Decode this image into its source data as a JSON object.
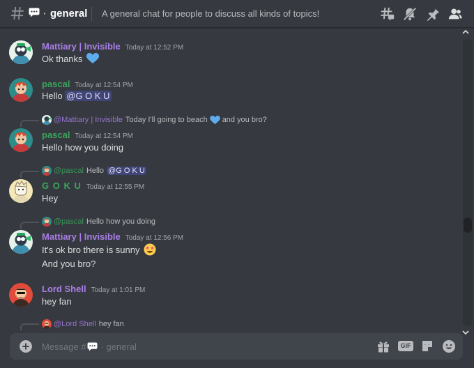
{
  "header": {
    "channel_dot": "·",
    "channel_name": "general",
    "topic": "A general chat for people to discuss all kinds of topics!",
    "icons": [
      "threads-icon",
      "mute-bell-icon",
      "pin-icon",
      "members-icon"
    ]
  },
  "colors": {
    "purple_name": "#a97ee7",
    "green_name": "#3ba55d",
    "mention_bg": "#414675",
    "bg": "#36393f"
  },
  "messages": [
    {
      "author": "Mattiary | Invisible",
      "time": "Today at 12:52 PM",
      "lines": [
        "Ok thanks"
      ]
    },
    {
      "author": "pascal",
      "time": "Today at 12:54 PM",
      "text_prefix": "Hello ",
      "mention": "@G O K U"
    },
    {
      "reply_author": "@Mattiary | Invisible",
      "reply_text": "Today I'll going to beach",
      "reply_suffix": "and you bro?",
      "author": "pascal",
      "time": "Today at 12:54 PM",
      "lines": [
        "Hello how you doing"
      ]
    },
    {
      "reply_author": "@pascal",
      "reply_text": "Hello",
      "reply_mention": "@G O K U",
      "author": "G O K U",
      "time": "Today at 12:55 PM",
      "lines": [
        "Hey"
      ]
    },
    {
      "reply_author": "@pascal",
      "reply_text": "Hello how you doing",
      "author": "Mattiary | Invisible",
      "time": "Today at 12:56 PM",
      "lines": [
        "It's ok bro there is sunny",
        "And you bro?"
      ]
    },
    {
      "author": "Lord Shell",
      "time": "Today at 1:01 PM",
      "lines": [
        "hey fan"
      ]
    },
    {
      "reply_author": "@Lord Shell",
      "reply_text": "hey fan"
    }
  ],
  "composer": {
    "placeholder_prefix": "Message #",
    "placeholder_suffix": "· general",
    "icons": [
      "gift-icon",
      "gif-icon",
      "sticker-icon",
      "emoji-icon"
    ],
    "gif_label": "GIF"
  }
}
